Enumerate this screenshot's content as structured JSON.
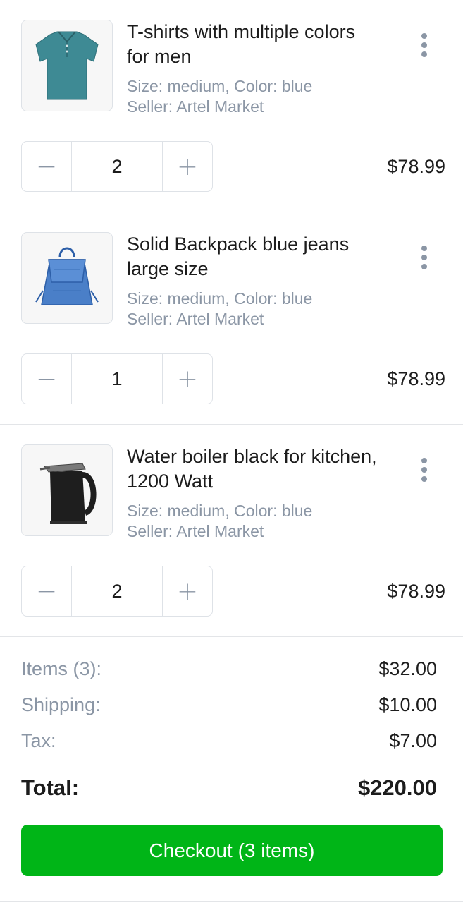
{
  "cart": {
    "items": [
      {
        "title": "T-shirts with multiple colors for men",
        "meta_line1": "Size: medium, Color: blue",
        "meta_line2": "Seller: Artel Market",
        "quantity": "2",
        "price": "$78.99",
        "image": "polo-shirt-image"
      },
      {
        "title": "Solid Backpack blue jeans large size",
        "meta_line1": "Size: medium, Color: blue",
        "meta_line2": "Seller: Artel Market",
        "quantity": "1",
        "price": "$78.99",
        "image": "backpack-image"
      },
      {
        "title": "Water boiler black for kitchen, 1200 Watt",
        "meta_line1": "Size: medium, Color: blue",
        "meta_line2": "Seller: Artel Market",
        "quantity": "2",
        "price": "$78.99",
        "image": "kettle-image"
      }
    ],
    "stepper": {
      "minus": "−",
      "plus": "+"
    }
  },
  "summary": {
    "items_label": "Items (3):",
    "items_value": "$32.00",
    "shipping_label": "Shipping:",
    "shipping_value": "$10.00",
    "tax_label": "Tax:",
    "tax_value": "$7.00",
    "total_label": "Total:",
    "total_value": "$220.00",
    "checkout_label": "Checkout (3 items)"
  },
  "colors": {
    "accent_green": "#00b517",
    "muted_text": "#8b96a5",
    "primary_text": "#1c1c1c",
    "border": "#dee2e7"
  }
}
